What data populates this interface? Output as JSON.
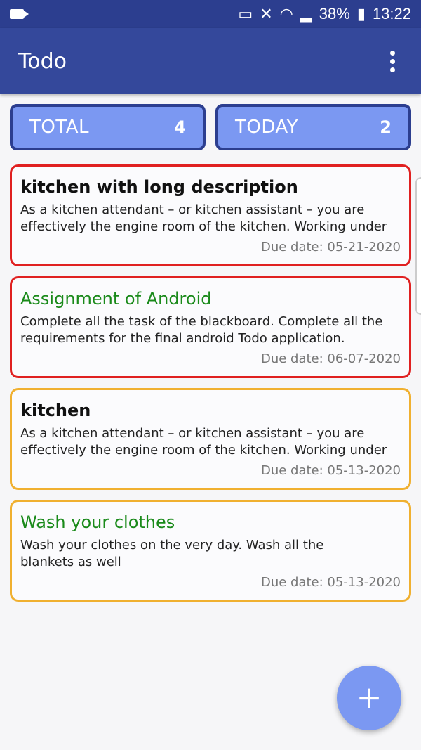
{
  "status_bar": {
    "battery": "38%",
    "time": "13:22",
    "icons": [
      "video-camera-icon",
      "cast-icon",
      "mute-icon",
      "wifi-icon",
      "signal-icon",
      "battery-icon"
    ]
  },
  "app_bar": {
    "title": "Todo",
    "menu_icon": "more-vert-icon"
  },
  "counters": {
    "total": {
      "label": "TOTAL",
      "value": "4"
    },
    "today": {
      "label": "TODAY",
      "value": "2"
    }
  },
  "tasks": [
    {
      "title": "kitchen with long description",
      "description": "As a kitchen attendant – or kitchen assistant – you are effectively the engine room of the kitchen. Working under t...",
      "due": "Due date: 05-21-2020",
      "border_color": "#e02020",
      "done": false
    },
    {
      "title": "Assignment of Android",
      "description": "Complete all the task of the blackboard. Complete all the requirements for the final android Todo application.",
      "due": "Due date: 06-07-2020",
      "border_color": "#e02020",
      "done": true
    },
    {
      "title": "kitchen",
      "description": "As a kitchen attendant – or kitchen assistant – you are effectively the engine room of the kitchen. Working under t...",
      "due": "Due date: 05-13-2020",
      "border_color": "#f0b030",
      "done": false
    },
    {
      "title": "Wash your clothes",
      "description": "Wash your clothes on the very day. Wash all the blankets as well",
      "due": "Due date: 05-13-2020",
      "border_color": "#f0b030",
      "done": true
    }
  ],
  "fab": {
    "label": "+",
    "icon": "add-icon"
  },
  "colors": {
    "app_bar": "#34489b",
    "status_bar": "#2c3e8f",
    "counter_bg": "#7b98f2",
    "done_title": "#1a8a1a"
  }
}
